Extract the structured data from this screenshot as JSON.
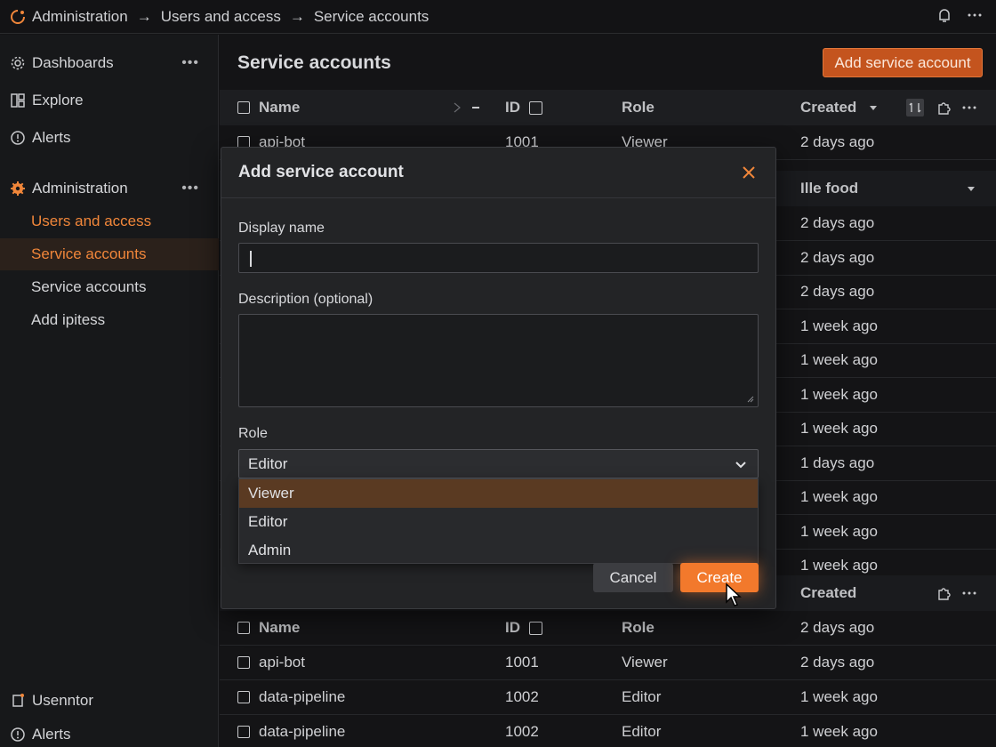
{
  "breadcrumb": {
    "items": [
      "Administration",
      "Users and access",
      "Service accounts"
    ],
    "separator": "→"
  },
  "sidebar": {
    "items": [
      {
        "label": "Dashboards",
        "icon": "gear-icon"
      },
      {
        "label": "Explore",
        "icon": "explore-icon"
      },
      {
        "label": "Alerts",
        "icon": "alert-icon"
      },
      {
        "label": "Administration",
        "icon": "cog-icon"
      }
    ],
    "sub_items": [
      "Users and access",
      "Service accounts",
      "Service accounts",
      "Add ipitess"
    ],
    "bottom": [
      {
        "label": "Usenntor",
        "icon": "user-icon"
      },
      {
        "label": "Alerts",
        "icon": "bell-icon"
      }
    ]
  },
  "main": {
    "title": "Service accounts",
    "add_button": "Add service account",
    "columns": {
      "name": "Name",
      "id": "ID",
      "role": "Role",
      "created": "Created"
    },
    "top_rows": [
      {
        "name": "api-bot",
        "id": "1001",
        "role": "Viewer",
        "created": "2 days ago"
      }
    ],
    "mid_header_label": "Ille food",
    "created_col": [
      "2 days ago",
      "2 days ago",
      "2 days ago",
      "1 week ago",
      "1 week ago",
      "1 week ago",
      "1 week ago",
      "1 days ago",
      "1 week ago",
      "1 week ago",
      "1 week ago"
    ],
    "bottom_header_created": "Created",
    "bottom_rows": [
      {
        "name": "Name",
        "id": "ID",
        "role": "Role",
        "created": "2 days ago"
      },
      {
        "name": "api-bot",
        "id": "1001",
        "role": "Viewer",
        "created": "2 days ago"
      },
      {
        "name": "data-pipeline",
        "id": "1002",
        "role": "Editor",
        "created": "1 week ago"
      },
      {
        "name": "data-pipeline",
        "id": "1002",
        "role": "Editor",
        "created": "1 week ago"
      }
    ]
  },
  "modal": {
    "title": "Add service account",
    "display_name_label": "Display name",
    "display_name_value": "",
    "description_label": "Description (optional)",
    "description_value": "",
    "role_label": "Role",
    "role_selected": "Editor",
    "role_options": [
      "Viewer",
      "Editor",
      "Admin"
    ],
    "highlighted_option": "Viewer",
    "cancel": "Cancel",
    "create": "Create"
  },
  "colors": {
    "accent": "#f2792c",
    "background": "#141416",
    "sidebar": "#17181a",
    "modal": "#232426",
    "active_nav": "#2b211b"
  }
}
